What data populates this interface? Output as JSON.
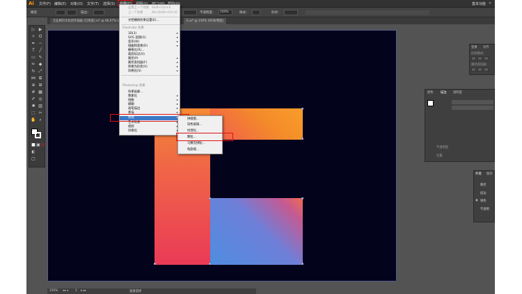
{
  "app": {
    "logo": "Ai",
    "workspace": "基本功能"
  },
  "menubar": {
    "items": [
      "文件(F)",
      "编辑(E)",
      "对象(O)",
      "文字(T)",
      "选择(S)",
      "效果(C)",
      "视图(V)",
      "窗口(W)",
      "帮助(H)"
    ]
  },
  "options_bar": {
    "path_label": "路径",
    "stroke_label": "描边：",
    "opacity_label": "不透明度：",
    "opacity_value": "100%",
    "style_label": "样式：",
    "shape_label": "形状："
  },
  "document_tabs": [
    "企业网页文化创作插画 [已恢复].ai* @ 66.67% (RGB/预览)",
    "E.ai* @ 150% (RGB/预览)"
  ],
  "effect_menu": {
    "top_items": [
      {
        "label": "应用上一个效果",
        "shortcut": "Shift+Ctrl+E"
      },
      {
        "label": "上一个效果",
        "shortcut": "Alt+Shift+Ctrl+E"
      }
    ],
    "document_raster": "文档栅格效果设置(E)...",
    "illustrator_header": "Illustrator 效果",
    "illustrator_items": [
      "3D(3)",
      "SVG 滤镜(G)",
      "变形(W)",
      "扭曲和变换(D)",
      "栅格化(R)...",
      "裁剪标记(O)",
      "路径(P)",
      "路径查找器(F)",
      "转换为形状(V)",
      "风格化(S)"
    ],
    "photoshop_header": "Photoshop 效果",
    "photoshop_items": [
      "效果画廊...",
      "像素化",
      "扭曲",
      "模糊",
      "画笔描边",
      "素描",
      "纹理",
      "艺术效果",
      "视频",
      "风格化"
    ],
    "selected": "纹理"
  },
  "texture_submenu": {
    "items": [
      "拼缀图...",
      "染色玻璃...",
      "纹理化...",
      "颗粒...",
      "马赛克拼贴...",
      "龟裂缝..."
    ],
    "highlighted": "颗粒..."
  },
  "panels": {
    "transform": {
      "tabs": [
        "变换",
        "对齐"
      ],
      "shape_mode_label": "形状模式：",
      "pathfinder_label": "路径查找器："
    },
    "stroke": {
      "tabs": [
        "颜色",
        "描边",
        "透明度"
      ],
      "rows": [
        "不透明度",
        "位置"
      ]
    },
    "appearance": {
      "tabs": [
        "外观",
        "图形"
      ],
      "rows": [
        "路径",
        "描边",
        "填色",
        "不透明"
      ]
    }
  },
  "status_bar": {
    "zoom": "150%",
    "page": "1",
    "tool": "直接选择"
  },
  "colors": {
    "accent": "#3b78c7",
    "highlight_box": "#e01010",
    "artboard": "#03031c"
  }
}
